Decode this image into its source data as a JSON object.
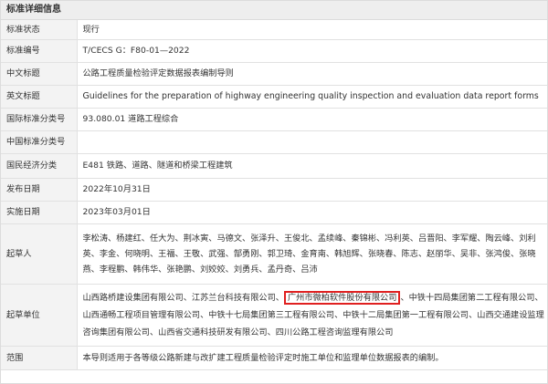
{
  "panel": {
    "title": "标准详细信息"
  },
  "rows": {
    "status": {
      "label": "标准状态",
      "value": "现行"
    },
    "number": {
      "label": "标准编号",
      "value": "T/CECS G：F80-01—2022"
    },
    "cn_title": {
      "label": "中文标题",
      "value": "公路工程质量检验评定数据报表编制导则"
    },
    "en_title": {
      "label": "英文标题",
      "value": "Guidelines for the preparation of highway engineering quality inspection and evaluation data report forms"
    },
    "intl_class": {
      "label": "国际标准分类号",
      "value": "93.080.01 道路工程综合"
    },
    "cn_class": {
      "label": "中国标准分类号",
      "value": ""
    },
    "econ_class": {
      "label": "国民经济分类",
      "value": "E481 铁路、道路、隧道和桥梁工程建筑"
    },
    "publish_date": {
      "label": "发布日期",
      "value": "2022年10月31日"
    },
    "impl_date": {
      "label": "实施日期",
      "value": "2023年03月01日"
    },
    "drafters": {
      "label": "起草人",
      "value": "李松涛、杨建红、任大为、荆冰寅、马德文、张泽升、王俊北、孟续峰、秦锦彬、冯利英、吕晋阳、李军耀、陶云峰、刘利英、李金、何晓明、王福、王敬、武强、郜勇刚、郭卫琦、金育南、韩旭辉、张晓春、陈志、赵丽华、吴非、张鸿俊、张晓燕、李程鹏、韩伟华、张艳鹏、刘姣姣、刘勇兵、孟丹奇、吕沛"
    },
    "units": {
      "label": "起草单位",
      "before": "山西路桥建设集团有限公司、江苏兰台科技有限公司、",
      "highlighted": "广州市微柏软件股份有限公司",
      "after": "、中铁十四局集团第二工程有限公司、山西通畅工程项目管理有限公司、中铁十七局集团第三工程有限公司、中铁十二局集团第一工程有限公司、山西交通建设监理咨询集团有限公司、山西省交通科技研发有限公司、四川公路工程咨询监理有限公司"
    },
    "scope": {
      "label": "范围",
      "value": "本导则适用于各等级公路新建与改扩建工程质量检验评定时施工单位和监理单位数据报表的编制。"
    }
  },
  "colors": {
    "highlight_border": "#e02020",
    "label_bg": "#f3f3f3",
    "header_bg": "#eeeeee"
  }
}
